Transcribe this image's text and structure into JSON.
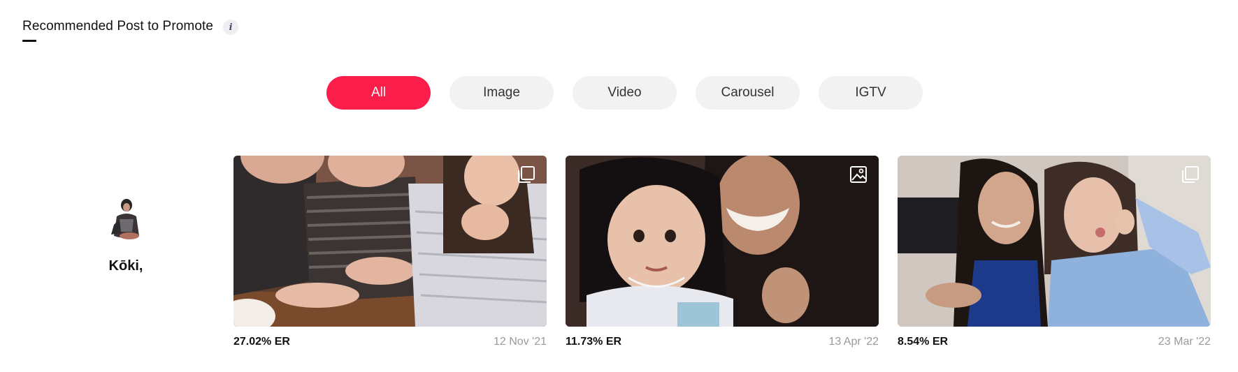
{
  "header": {
    "title": "Recommended Post to Promote",
    "info_icon": "info-icon"
  },
  "filters": {
    "tabs": [
      {
        "label": "All",
        "active": true
      },
      {
        "label": "Image",
        "active": false
      },
      {
        "label": "Video",
        "active": false
      },
      {
        "label": "Carousel",
        "active": false
      },
      {
        "label": "IGTV",
        "active": false
      }
    ],
    "active_color": "#fb1d4a"
  },
  "profile": {
    "name": "Kōki,"
  },
  "posts": [
    {
      "er": "27.02% ER",
      "date": "12 Nov '21",
      "type_icon": "carousel-icon"
    },
    {
      "er": "11.73% ER",
      "date": "13 Apr '22",
      "type_icon": "image-icon"
    },
    {
      "er": "8.54% ER",
      "date": "23 Mar '22",
      "type_icon": "carousel-icon"
    }
  ]
}
